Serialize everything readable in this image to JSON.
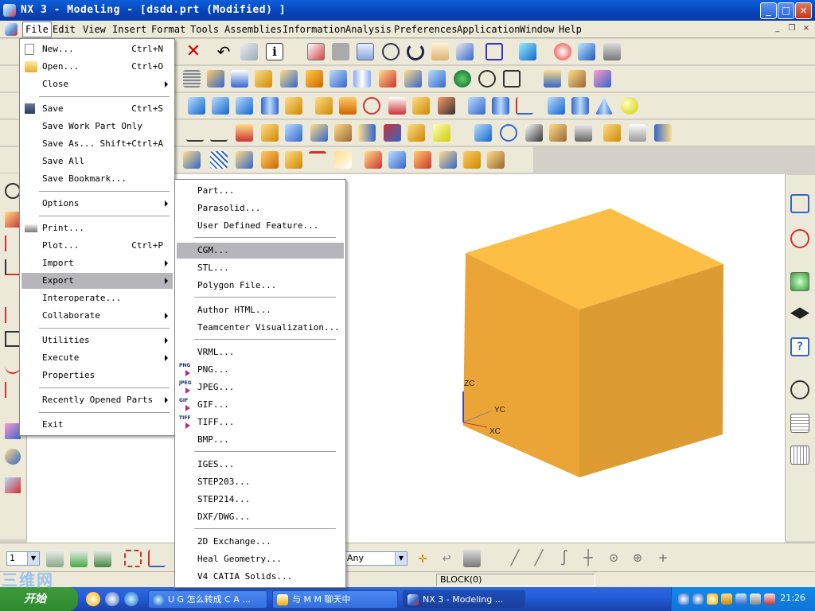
{
  "window": {
    "title": "NX 3 - Modeling - [dsdd.prt (Modified) ]",
    "buttons": [
      "_",
      "□",
      "×"
    ]
  },
  "menubar": [
    "File",
    "Edit",
    "View",
    "Insert",
    "Format",
    "Tools",
    "Assemblies",
    "Information",
    "Analysis",
    "Preferences",
    "Application",
    "Window",
    "Help"
  ],
  "file_menu": {
    "new": {
      "label": "New...",
      "shortcut": "Ctrl+N"
    },
    "open": {
      "label": "Open...",
      "shortcut": "Ctrl+O"
    },
    "close": {
      "label": "Close"
    },
    "save": {
      "label": "Save",
      "shortcut": "Ctrl+S"
    },
    "save_work_part_only": {
      "label": "Save Work Part Only"
    },
    "save_as": {
      "label": "Save As...",
      "shortcut": "Shift+Ctrl+A"
    },
    "save_all": {
      "label": "Save All"
    },
    "save_bookmark": {
      "label": "Save Bookmark..."
    },
    "options": {
      "label": "Options"
    },
    "print": {
      "label": "Print..."
    },
    "plot": {
      "label": "Plot...",
      "shortcut": "Ctrl+P"
    },
    "import": {
      "label": "Import"
    },
    "export": {
      "label": "Export"
    },
    "interoperate": {
      "label": "Interoperate..."
    },
    "collaborate": {
      "label": "Collaborate"
    },
    "utilities": {
      "label": "Utilities"
    },
    "execute": {
      "label": "Execute"
    },
    "properties": {
      "label": "Properties"
    },
    "recently_opened_parts": {
      "label": "Recently Opened Parts"
    },
    "exit": {
      "label": "Exit"
    }
  },
  "export_menu": {
    "part": "Part...",
    "parasolid": "Parasolid...",
    "user_defined_feature": "User Defined Feature...",
    "cgm": "CGM...",
    "stl": "STL...",
    "polygon_file": "Polygon File...",
    "author_html": "Author HTML...",
    "teamcenter_visualization": "Teamcenter Visualization...",
    "vrml": "VRML...",
    "png": "PNG...",
    "jpeg": "JPEG...",
    "gif": "GIF...",
    "tiff": "TIFF...",
    "bmp": "BMP...",
    "iges": "IGES...",
    "step203": "STEP203...",
    "step214": "STEP214...",
    "dxf_dwg": "DXF/DWG...",
    "two_d_exchange": "2D Exchange...",
    "heal_geometry": "Heal Geometry...",
    "v4_catia_solids": "V4 CATIA Solids...",
    "icon_labels": {
      "png": "PNG",
      "jpeg": "JPEG",
      "gif": "GIF",
      "tiff": "TIFF"
    }
  },
  "graphics": {
    "axes": {
      "zc": "ZC",
      "yc": "YC",
      "xc": "XC"
    },
    "block_color": "#f0a838"
  },
  "selection_bar": {
    "layer_value": "1",
    "filter_value": "Any"
  },
  "status": {
    "text": "BLOCK(0)"
  },
  "taskbar": {
    "start_label": "开始",
    "watermark": "三维网",
    "tasks": [
      "U G 怎么转成 C A ...",
      "与 M M 聊天中",
      "NX 3 - Modeling ..."
    ],
    "clock": "21:26"
  }
}
